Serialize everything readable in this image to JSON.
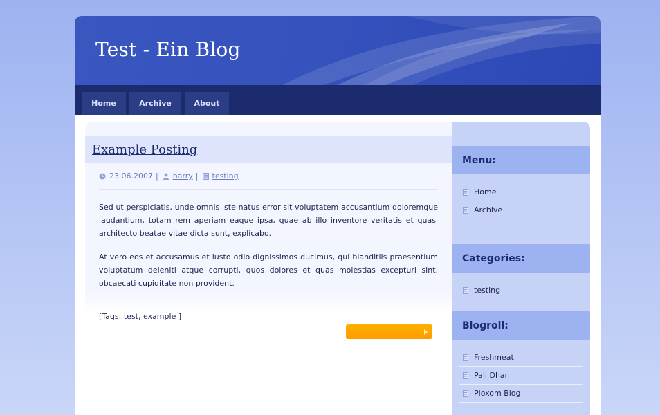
{
  "site": {
    "title": "Test - Ein Blog"
  },
  "nav": {
    "items": [
      "Home",
      "Archive",
      "About"
    ]
  },
  "post": {
    "title": "Example Posting",
    "date": "23.06.2007",
    "author": "harry",
    "category": "testing",
    "paragraphs": [
      "Sed ut perspiciatis, unde omnis iste natus error sit voluptatem accusantium doloremque laudantium, totam rem aperiam eaque ipsa, quae ab illo inventore veritatis et quasi architecto beatae vitae dicta sunt, explicabo.",
      "At vero eos et accusamus et iusto odio dignissimos ducimus, qui blanditiis praesentium voluptatum deleniti atque corrupti, quos dolores et quas molestias excepturi sint, obcaecati cupiditate non provident."
    ],
    "tags_prefix": "[Tags: ",
    "tags": [
      "test",
      "example"
    ],
    "tags_suffix": " ]"
  },
  "sidebar": {
    "menu": {
      "heading": "Menu:",
      "items": [
        "Home",
        "Archive"
      ]
    },
    "categories": {
      "heading": "Categories:",
      "items": [
        "testing"
      ]
    },
    "blogroll": {
      "heading": "Blogroll:",
      "items": [
        "Freshmeat",
        "Pali Dhar",
        "Ploxom Blog"
      ]
    }
  },
  "colors": {
    "header": "#3552bd",
    "navbar": "#1c2b6e",
    "accent": "#ff9a00",
    "sidebar": "#c6d3f7"
  }
}
